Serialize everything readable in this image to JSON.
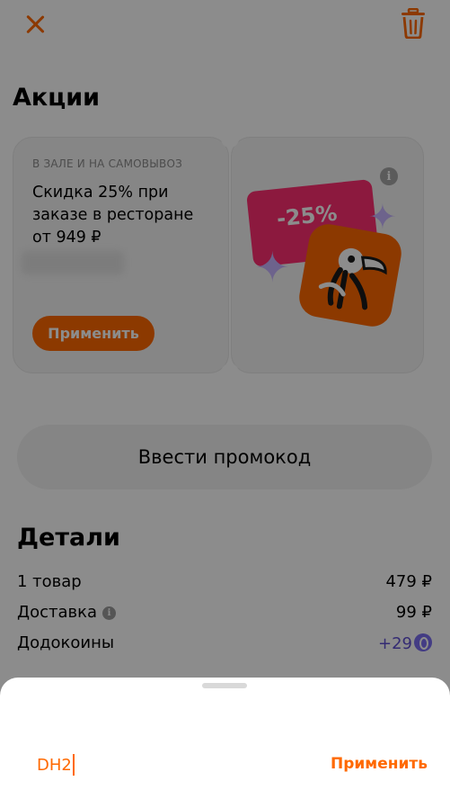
{
  "colors": {
    "accent": "#ff6900",
    "coins": "#5f4fd1",
    "ticket": "#ff2f72"
  },
  "header": {
    "close_icon": "close-icon",
    "trash_icon": "trash-icon"
  },
  "promotions": {
    "title": "Акции",
    "card": {
      "caption": "В ЗАЛЕ И НА САМОВЫВОЗ",
      "description": "Скидка 25% при заказе в ресторане от 949 ₽",
      "apply_label": "Применить",
      "badge_text": "-25%",
      "info_icon": "i"
    }
  },
  "enter_promo_label": "Ввести промокод",
  "details": {
    "title": "Детали",
    "rows": [
      {
        "label": "1 товар",
        "value": "479 ₽"
      },
      {
        "label": "Доставка",
        "value": "99 ₽",
        "info": "i"
      },
      {
        "label": "Додокоины",
        "value": "+29"
      }
    ]
  },
  "sheet": {
    "input_value": "DH2",
    "apply_label": "Применить"
  }
}
